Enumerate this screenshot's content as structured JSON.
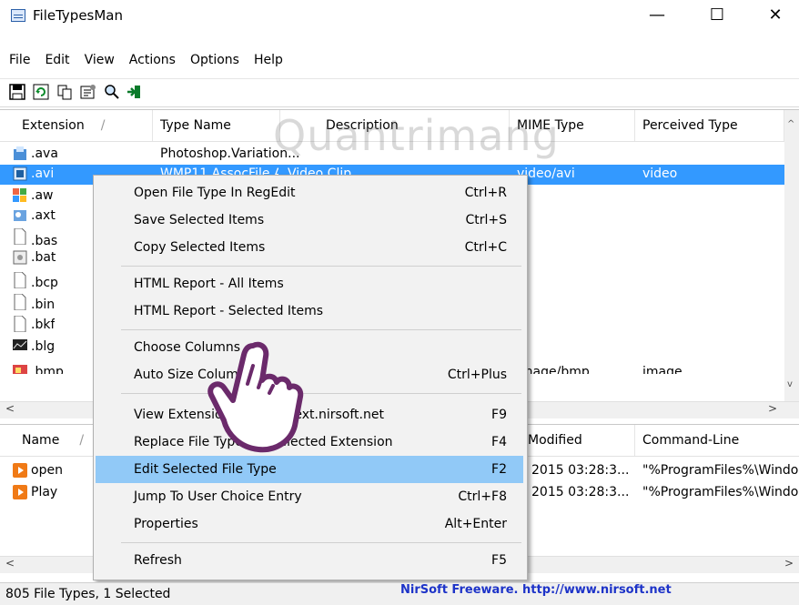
{
  "window": {
    "title": "FileTypesMan"
  },
  "menubar": [
    "File",
    "Edit",
    "View",
    "Actions",
    "Options",
    "Help"
  ],
  "watermark": "Quantrimang",
  "top_list": {
    "columns": [
      "Extension",
      "Type Name",
      "Description",
      "MIME Type",
      "Perceived Type"
    ],
    "rows": [
      {
        "ext": ".ava",
        "type": "Photoshop.Variation...",
        "mime": "",
        "perceived": ""
      },
      {
        "ext": ".avi",
        "type": "WMP11.AssocFile.AVI",
        "description": "Video Clip",
        "mime": "video/avi",
        "perceived": "video",
        "selected": true
      },
      {
        "ext": ".aw",
        "type": ""
      },
      {
        "ext": ".axt",
        "type": ""
      },
      {
        "ext": ".bas",
        "type": ""
      },
      {
        "ext": ".bat",
        "type": ""
      },
      {
        "ext": ".bcp",
        "type": ""
      },
      {
        "ext": ".bin",
        "type": ""
      },
      {
        "ext": ".bkf",
        "type": ""
      },
      {
        "ext": ".blg",
        "type": ""
      },
      {
        "ext": ".bmp",
        "type": "",
        "mime": "image/bmp",
        "perceived": "image"
      }
    ]
  },
  "bottom_list": {
    "columns": [
      "Name",
      "Modified",
      "Command-Line"
    ],
    "rows": [
      {
        "name": "open",
        "modified": "2015 03:28:3...",
        "cmd": "\"%ProgramFiles%\\Windo"
      },
      {
        "name": "Play",
        "modified": "2015 03:28:3...",
        "cmd": "\"%ProgramFiles%\\Windo"
      }
    ]
  },
  "context_menu": [
    {
      "label": "Open File Type In RegEdit",
      "shortcut": "Ctrl+R"
    },
    {
      "label": "Save Selected Items",
      "shortcut": "Ctrl+S"
    },
    {
      "label": "Copy Selected Items",
      "shortcut": "Ctrl+C"
    },
    {
      "label": "HTML Report - All Items",
      "shortcut": ""
    },
    {
      "label": "HTML Report - Selected Items",
      "shortcut": ""
    },
    {
      "label": "Choose Columns",
      "shortcut": ""
    },
    {
      "label": "Auto Size Columns",
      "shortcut": "Ctrl+Plus"
    },
    {
      "label": "View Extension Info on filext.nirsoft.net",
      "shortcut": "F9"
    },
    {
      "label": "Replace File Type For Selected Extension",
      "shortcut": "F4"
    },
    {
      "label": "Edit Selected File Type",
      "shortcut": "F2",
      "highlighted": true
    },
    {
      "label": "Jump To User Choice Entry",
      "shortcut": "Ctrl+F8"
    },
    {
      "label": "Properties",
      "shortcut": "Alt+Enter"
    },
    {
      "label": "Refresh",
      "shortcut": "F5"
    }
  ],
  "status": {
    "text": "805 File Types, 1 Selected",
    "link": "NirSoft Freeware.  http://www.nirsoft.net"
  },
  "colors": {
    "selection": "#3399ff",
    "menu_highlight": "#91c9f7",
    "link": "#1d33c8"
  }
}
